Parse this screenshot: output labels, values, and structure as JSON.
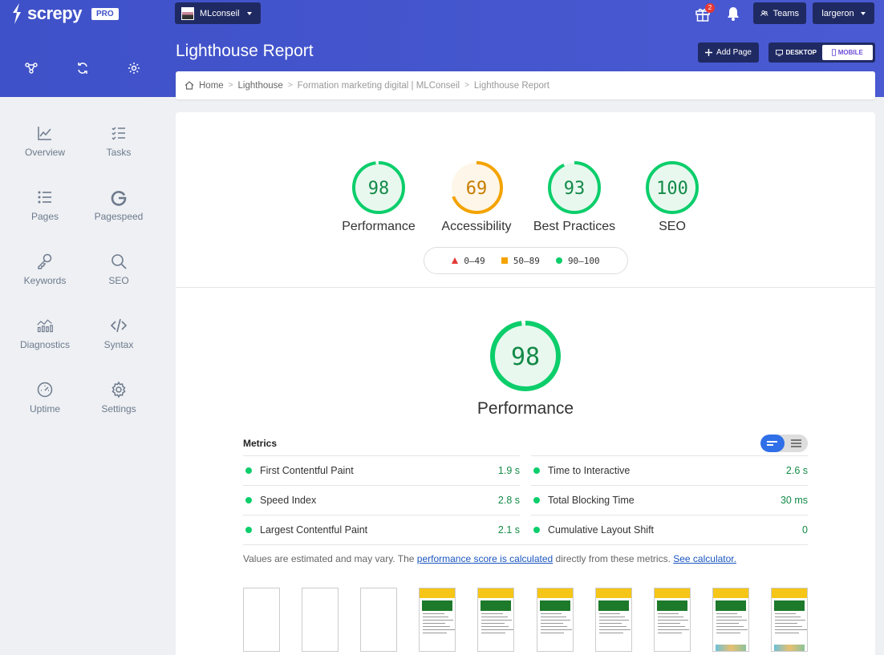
{
  "app": {
    "logo": "screpy",
    "badge": "PRO"
  },
  "header": {
    "project": "MLconseil",
    "gift_count": "2",
    "teams_label": "Teams",
    "user_label": "largeron"
  },
  "page": {
    "title": "Lighthouse Report",
    "add_page_label": "Add Page",
    "device_desktop": "DESKTOP",
    "device_mobile": "MOBILE",
    "device_active": "mobile"
  },
  "breadcrumb": [
    "Home",
    "Lighthouse",
    "Formation marketing digital | MLConseil",
    "Lighthouse Report"
  ],
  "sidebar": {
    "items": [
      {
        "label": "Overview",
        "icon": "chart-line-icon"
      },
      {
        "label": "Tasks",
        "icon": "task-list-icon"
      },
      {
        "label": "Pages",
        "icon": "list-icon"
      },
      {
        "label": "Pagespeed",
        "icon": "google-icon"
      },
      {
        "label": "Keywords",
        "icon": "key-icon"
      },
      {
        "label": "SEO",
        "icon": "search-icon"
      },
      {
        "label": "Diagnostics",
        "icon": "bar-chart-icon"
      },
      {
        "label": "Syntax",
        "icon": "code-icon"
      },
      {
        "label": "Uptime",
        "icon": "speedometer-icon"
      },
      {
        "label": "Settings",
        "icon": "gear-icon"
      }
    ]
  },
  "scores": [
    {
      "label": "Performance",
      "value": "98",
      "status": "good"
    },
    {
      "label": "Accessibility",
      "value": "69",
      "status": "average"
    },
    {
      "label": "Best Practices",
      "value": "93",
      "status": "good"
    },
    {
      "label": "SEO",
      "value": "100",
      "status": "good"
    }
  ],
  "legend": {
    "fail": "0–49",
    "average": "50–89",
    "pass": "90–100"
  },
  "performance": {
    "score": "98",
    "label": "Performance"
  },
  "metrics": {
    "title": "Metrics",
    "left": [
      {
        "name": "First Contentful Paint",
        "value": "1.9 s"
      },
      {
        "name": "Speed Index",
        "value": "2.8 s"
      },
      {
        "name": "Largest Contentful Paint",
        "value": "2.1 s"
      }
    ],
    "right": [
      {
        "name": "Time to Interactive",
        "value": "2.6 s"
      },
      {
        "name": "Total Blocking Time",
        "value": "30 ms"
      },
      {
        "name": "Cumulative Layout Shift",
        "value": "0"
      }
    ],
    "note_prefix": "Values are estimated and may vary. The ",
    "note_link": "performance score is calculated",
    "note_middle": " directly from these metrics. ",
    "note_link2": "See calculator."
  },
  "colors": {
    "good": "#0cce6b",
    "average": "#f4a300",
    "fail": "#e53935",
    "brand": "#3f51c8"
  },
  "filmstrip": {
    "blank_frames": 3,
    "rendered_frames": 7
  }
}
